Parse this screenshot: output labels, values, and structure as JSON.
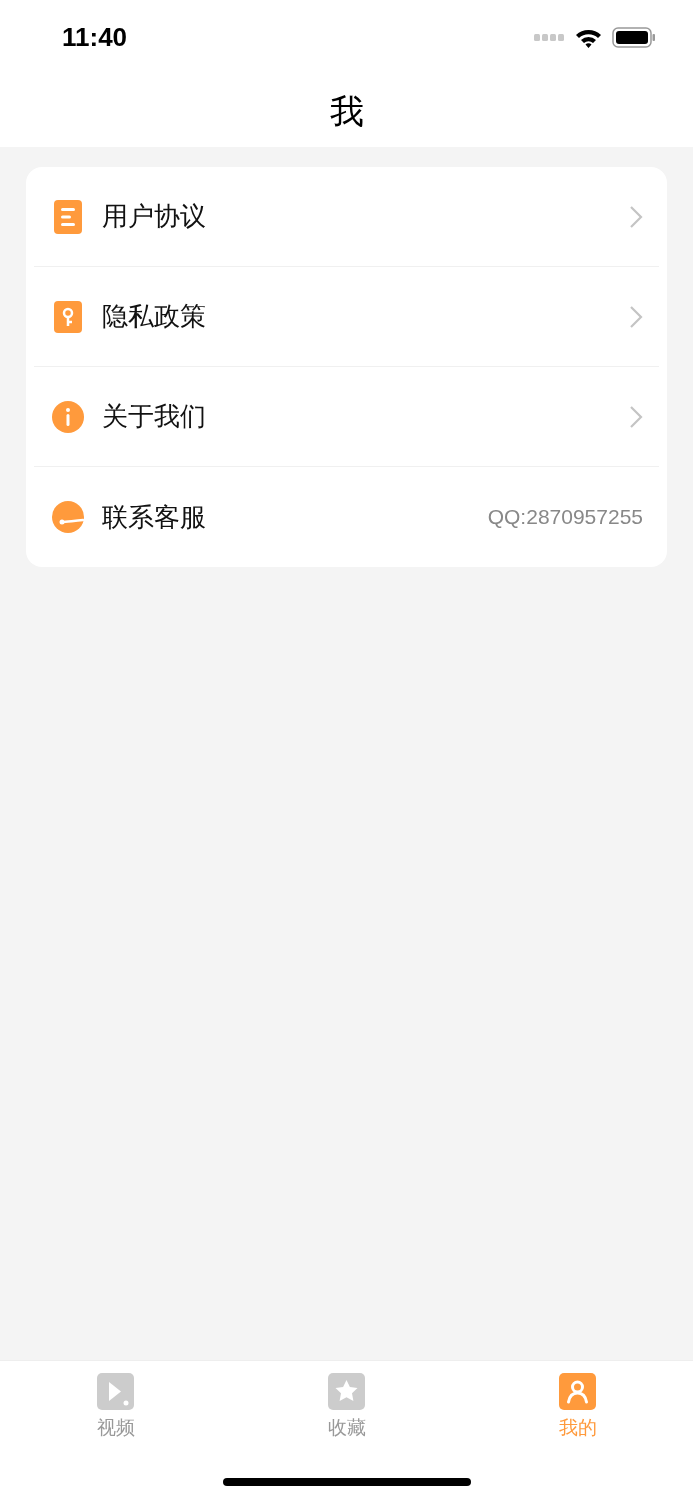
{
  "status_bar": {
    "time": "11:40"
  },
  "header": {
    "title": "我"
  },
  "menu": [
    {
      "kind": "link",
      "label": "用户协议"
    },
    {
      "kind": "link",
      "label": "隐私政策"
    },
    {
      "kind": "link",
      "label": "关于我们"
    },
    {
      "kind": "value",
      "label": "联系客服",
      "value": "QQ:2870957255"
    }
  ],
  "tabs": [
    {
      "label": "视频",
      "selected": false
    },
    {
      "label": "收藏",
      "selected": false
    },
    {
      "label": "我的",
      "selected": true
    }
  ]
}
